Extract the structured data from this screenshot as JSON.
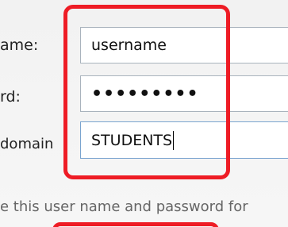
{
  "form": {
    "username_label": "ame:",
    "password_label": "rd:",
    "domain_label": "domain",
    "username_value": "username",
    "password_value": "•••••••••",
    "domain_value": "STUDENTS"
  },
  "remember_text": "e this user name and password for",
  "colors": {
    "highlight": "#ee1c25",
    "field_border": "#a9b3bd",
    "field_focus_border": "#7aa4cf"
  }
}
